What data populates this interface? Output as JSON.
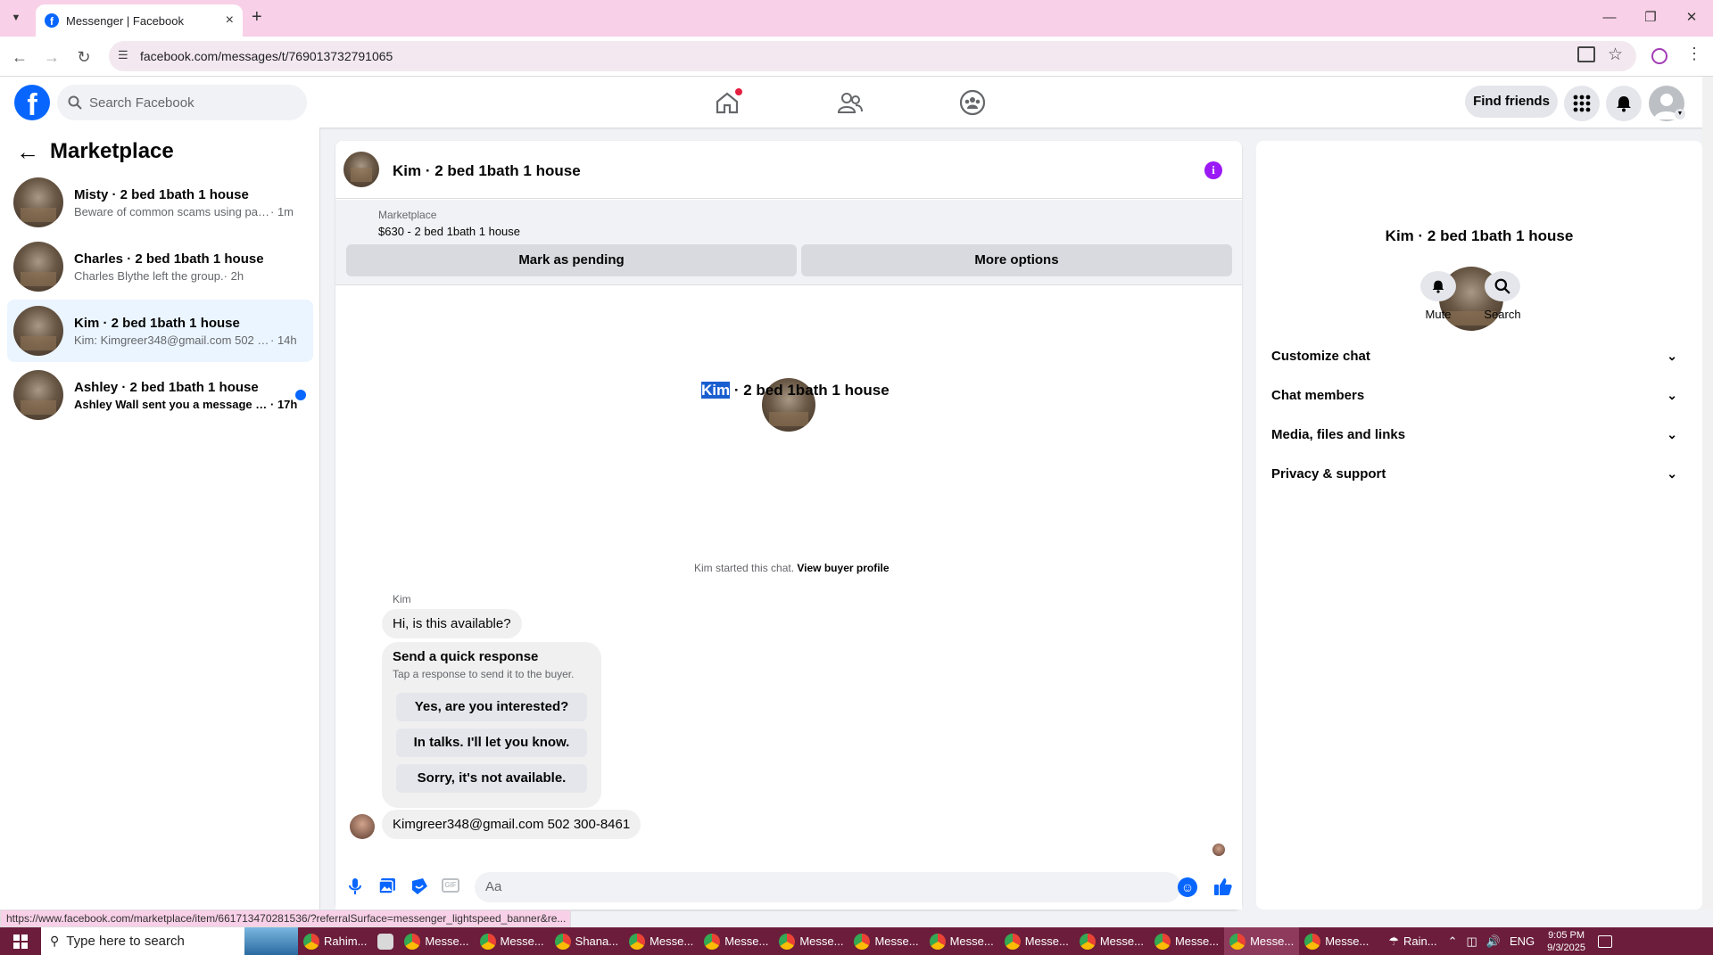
{
  "browser": {
    "tab_title": "Messenger | Facebook",
    "url": "facebook.com/messages/t/769013732791065",
    "new_tab": "+",
    "close_tab": "×"
  },
  "fb": {
    "logo": "f",
    "search_placeholder": "Search Facebook",
    "find_friends": "Find friends"
  },
  "left": {
    "title": "Marketplace",
    "conversations": [
      {
        "title": "Misty · 2 bed 1bath 1 house",
        "preview": "Beware of common scams using pay...",
        "time": " · 1m"
      },
      {
        "title": "Charles · 2 bed 1bath 1 house",
        "preview": "Charles Blythe left the group.",
        "time": " · 2h"
      },
      {
        "title": "Kim · 2 bed 1bath 1 house",
        "preview": "Kim: Kimgreer348@gmail.com 502 3...",
        "time": " · 14h"
      },
      {
        "title": "Ashley · 2 bed 1bath 1 house",
        "preview": "Ashley Wall sent you a message a...",
        "time": " · 17h"
      }
    ]
  },
  "chat": {
    "header_title": "Kim · 2 bed 1bath 1 house",
    "listing_label": "Marketplace",
    "listing_price": "$630 - 2 bed 1bath 1 house",
    "mark_pending": "Mark as pending",
    "more_options": "More options",
    "center_name_highlight": "Kim",
    "center_name_rest": " · 2 bed 1bath 1 house",
    "started_text": "Kim started this chat. ",
    "view_buyer": "View buyer profile",
    "sender": "Kim",
    "msg1": "Hi, is this available?",
    "quick_title": "Send a quick response",
    "quick_sub": "Tap a response to send it to the buyer.",
    "quick_replies": [
      "Yes, are you interested?",
      "In talks. I'll let you know.",
      "Sorry, it's not available."
    ],
    "msg2": "Kimgreer348@gmail.com 502 300-8461",
    "composer_placeholder": "Aa"
  },
  "right": {
    "title": "Kim · 2 bed 1bath 1 house",
    "mute": "Mute",
    "search": "Search",
    "sections": [
      "Customize chat",
      "Chat members",
      "Media, files and links",
      "Privacy & support"
    ]
  },
  "status_url": "https://www.facebook.com/marketplace/item/661713470281536/?referralSurface=messenger_lightspeed_banner&re...",
  "taskbar": {
    "search": "Type here to search",
    "apps": [
      "Rahim...",
      "",
      "Messe...",
      "Messe...",
      "Shana...",
      "Messe...",
      "Messe...",
      "Messe...",
      "Messe...",
      "Messe...",
      "Messe...",
      "Messe...",
      "Messe...",
      "Messe...",
      "Messe..."
    ],
    "weather": "Rain...",
    "lang": "ENG",
    "time": "9:05 PM",
    "date": "9/3/2025"
  },
  "colors": {
    "accent": "#0866ff",
    "tabbar": "#f8d0e7",
    "taskbar": "#6b1d3b",
    "info": "#9b19f5"
  }
}
